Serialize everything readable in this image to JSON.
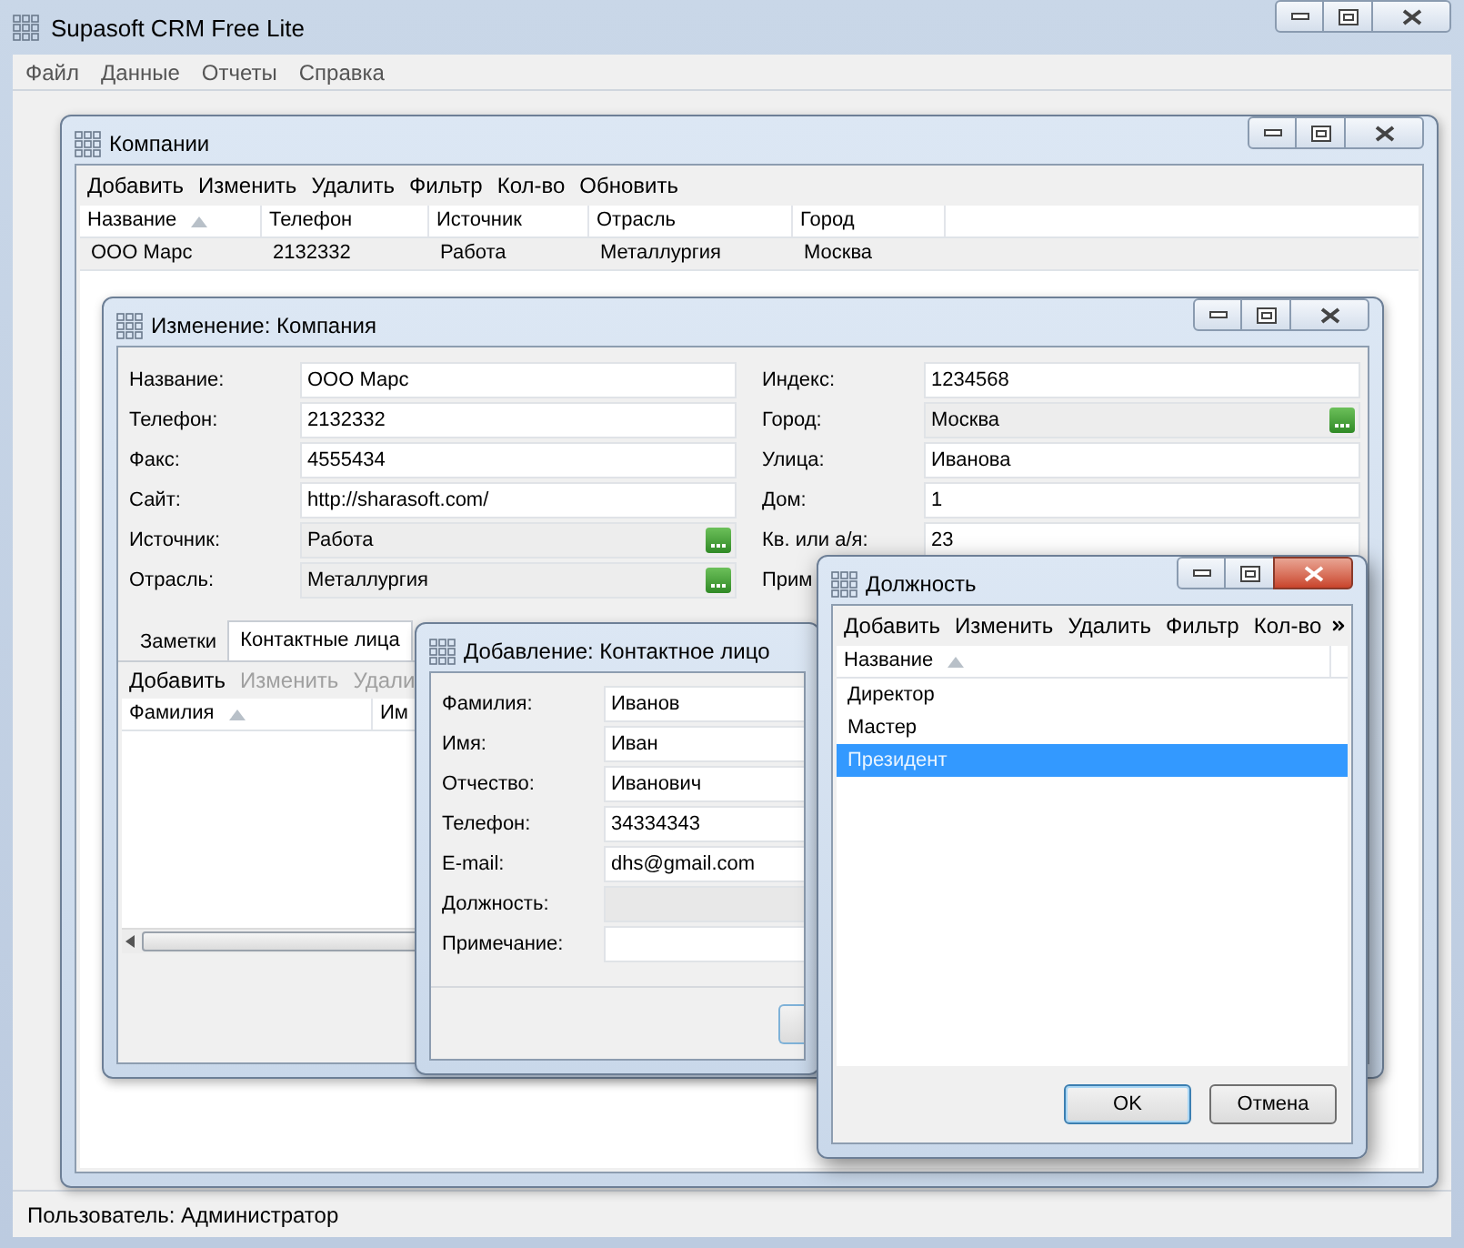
{
  "window": {
    "title": "Supasoft CRM Free Lite"
  },
  "menu": [
    "Файл",
    "Данные",
    "Отчеты",
    "Справка"
  ],
  "companies_window": {
    "title": "Компании",
    "active": false,
    "toolbar": [
      "Добавить",
      "Изменить",
      "Удалить",
      "Фильтр",
      "Кол-во",
      "Обновить"
    ],
    "columns": [
      {
        "label": "Название",
        "sorted": true
      },
      {
        "label": "Телефон",
        "sorted": false
      },
      {
        "label": "Источник",
        "sorted": false
      },
      {
        "label": "Отрасль",
        "sorted": false
      },
      {
        "label": "Город",
        "sorted": false
      }
    ],
    "rows": [
      [
        "ООО Марс",
        "2132332",
        "Работа",
        "Металлургия",
        "Москва"
      ]
    ]
  },
  "edit_window": {
    "title": "Изменение: Компания",
    "active": false,
    "left_fields": [
      {
        "label": "Название:",
        "value": "ООО Марс",
        "kind": "text"
      },
      {
        "label": "Телефон:",
        "value": "2132332",
        "kind": "text"
      },
      {
        "label": "Факс:",
        "value": "4555434",
        "kind": "text"
      },
      {
        "label": "Сайт:",
        "value": "http://sharasoft.com/",
        "kind": "text"
      },
      {
        "label": "Источник:",
        "value": "Работа",
        "kind": "lookup"
      },
      {
        "label": "Отрасль:",
        "value": "Металлургия",
        "kind": "lookup"
      }
    ],
    "right_fields": [
      {
        "label": "Индекс:",
        "value": "1234568",
        "kind": "text"
      },
      {
        "label": "Город:",
        "value": "Москва",
        "kind": "lookup"
      },
      {
        "label": "Улица:",
        "value": "Иванова",
        "kind": "text"
      },
      {
        "label": "Дом:",
        "value": "1",
        "kind": "text"
      },
      {
        "label": "Кв. или а/я:",
        "value": "23",
        "kind": "text"
      },
      {
        "label": "Прим",
        "kind": "label"
      }
    ],
    "tabs": [
      {
        "label": "Заметки",
        "selected": false
      },
      {
        "label": "Контактные лица",
        "selected": true
      }
    ],
    "toolbar": [
      {
        "label": "Добавить",
        "disabled": false
      },
      {
        "label": "Изменить",
        "disabled": true
      },
      {
        "label": "Удали",
        "disabled": true
      }
    ],
    "columns": [
      {
        "label": "Фамилия",
        "sorted": true
      },
      {
        "label": "Им"
      }
    ]
  },
  "contact_window": {
    "title": "Добавление: Контактное лицо",
    "fields": [
      {
        "label": "Фамилия:",
        "value": "Иванов",
        "kind": "text"
      },
      {
        "label": "Имя:",
        "value": "Иван",
        "kind": "text"
      },
      {
        "label": "Отчество:",
        "value": "Иванович",
        "kind": "text"
      },
      {
        "label": "Телефон:",
        "value": "34334343",
        "kind": "text"
      },
      {
        "label": "E-mail:",
        "value": "dhs@gmail.com",
        "kind": "text"
      },
      {
        "label": "Должность:",
        "kind": "readonly"
      },
      {
        "label": "Примечание:",
        "kind": "text"
      }
    ]
  },
  "position_window": {
    "title": "Должность",
    "active": true,
    "toolbar": [
      "Добавить",
      "Изменить",
      "Удалить",
      "Фильтр",
      "Кол-во"
    ],
    "columns": [
      {
        "label": "Название",
        "sorted": true
      }
    ],
    "rows": [
      {
        "name": "Директор",
        "selected": false
      },
      {
        "name": "Мастер",
        "selected": false
      },
      {
        "name": "Президент",
        "selected": true
      }
    ],
    "buttons": [
      {
        "label": "OK",
        "default": true
      },
      {
        "label": "Отмена",
        "default": false
      }
    ]
  },
  "status_bar": "Пользователь: Администратор"
}
